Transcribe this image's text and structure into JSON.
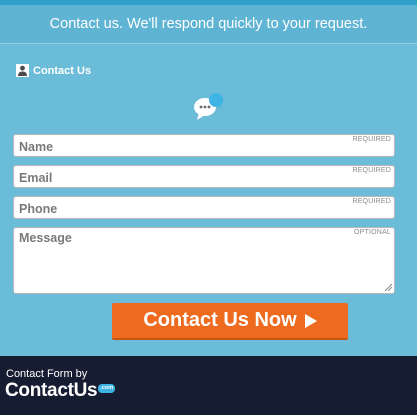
{
  "header": {
    "title": "Contact us. We'll respond quickly to your request."
  },
  "form": {
    "section_label": "Contact Us",
    "fields": [
      {
        "placeholder": "Name",
        "tag": "REQUIRED"
      },
      {
        "placeholder": "Email",
        "tag": "REQUIRED"
      },
      {
        "placeholder": "Phone",
        "tag": "REQUIRED"
      },
      {
        "placeholder": "Message",
        "tag": "OPTIONAL"
      }
    ],
    "submit_label": "Contact Us Now"
  },
  "footer": {
    "by_text": "Contact Form by",
    "brand": "ContactUs",
    "brand_badge": ".com"
  },
  "colors": {
    "background": "#6bbcd8",
    "header": "#5fb4d4",
    "button": "#ee6a1f",
    "footer": "#161d32",
    "icon_accent": "#3db4e4"
  },
  "icons": [
    "user-icon",
    "chat-bubble-icon",
    "play-icon",
    "resize-grip-icon"
  ]
}
